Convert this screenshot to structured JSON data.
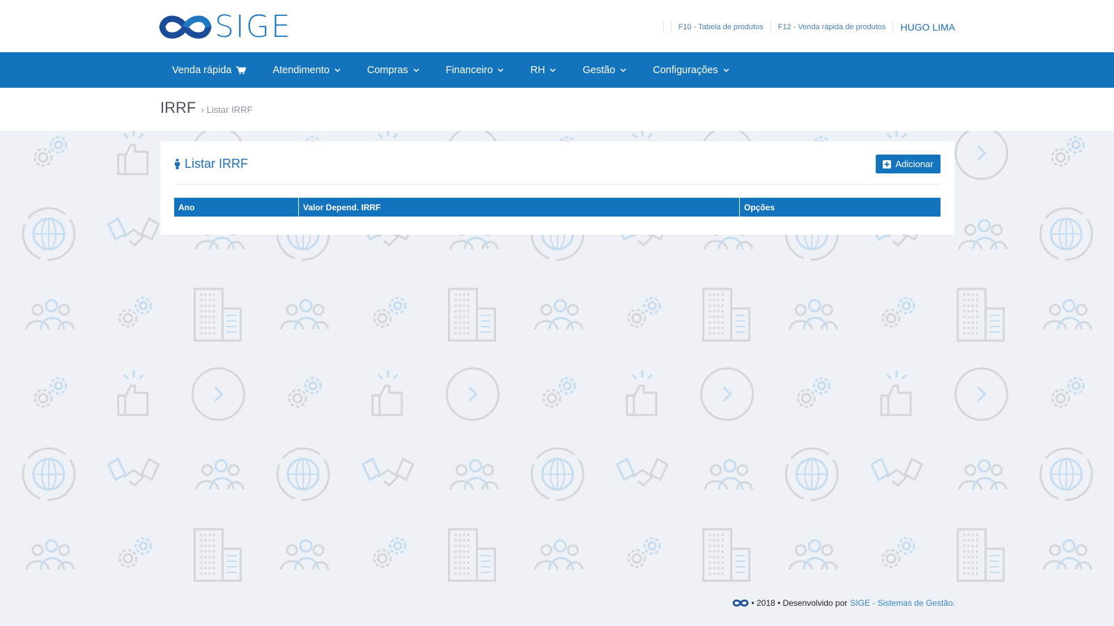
{
  "header": {
    "logo_text": "SIGE",
    "links": [
      {
        "label": "F10 - Tabela de produtos"
      },
      {
        "label": "F12 - Venda rápida de produtos"
      }
    ],
    "user": "HUGO LIMA"
  },
  "nav": {
    "items": [
      {
        "label": "Venda rápida",
        "icon": "cart-icon"
      },
      {
        "label": "Atendimento",
        "icon": "chevron-down-icon"
      },
      {
        "label": "Compras",
        "icon": "chevron-down-icon"
      },
      {
        "label": "Financeiro",
        "icon": "chevron-down-icon"
      },
      {
        "label": "RH",
        "icon": "chevron-down-icon"
      },
      {
        "label": "Gestão",
        "icon": "chevron-down-icon"
      },
      {
        "label": "Configurações",
        "icon": "chevron-down-icon"
      }
    ]
  },
  "breadcrumb": {
    "title": "IRRF",
    "separator": "›",
    "current": "Listar IRRF"
  },
  "panel": {
    "title": "Listar IRRF",
    "add_label": "Adicionar",
    "columns": [
      "Ano",
      "Valor Depend. IRRF",
      "Opções"
    ]
  },
  "footer": {
    "text": "• 2018 • Desenvolvido por",
    "link": "SIGE - Sistemas de Gestão."
  },
  "colors": {
    "primary": "#1473bd",
    "background": "#eef1f5",
    "pattern_gray": "#d3d7dc",
    "pattern_blue": "#c6dcf0"
  }
}
